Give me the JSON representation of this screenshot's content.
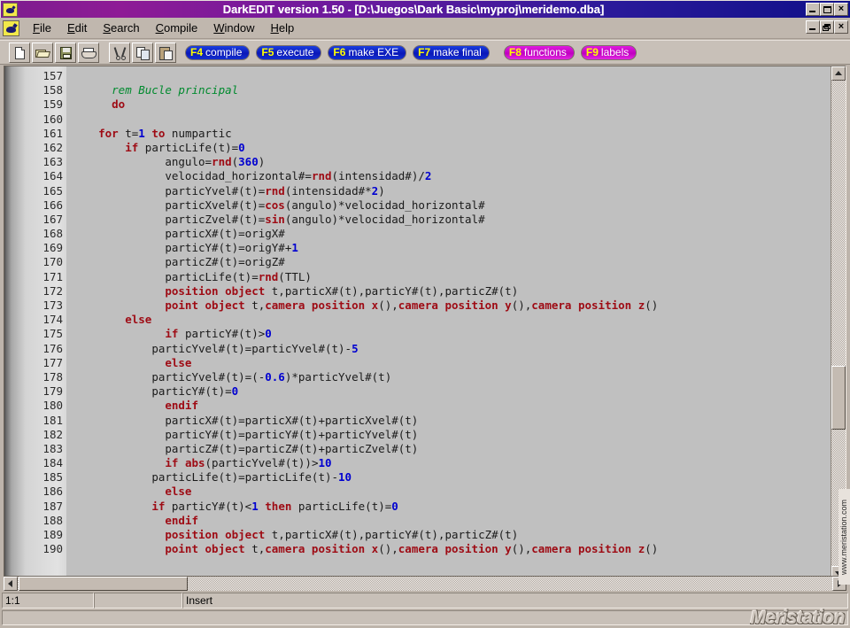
{
  "window": {
    "title": "DarkEDIT version 1.50 - [D:\\Juegos\\Dark Basic\\myproj\\meridemo.dba]",
    "app_icon": "darkedit-icon",
    "controls": [
      "minimize",
      "maximize",
      "close"
    ],
    "mdi_controls": [
      "minimize",
      "restore",
      "close"
    ]
  },
  "menu": {
    "items": [
      {
        "label": "File",
        "accel": "F"
      },
      {
        "label": "Edit",
        "accel": "E"
      },
      {
        "label": "Search",
        "accel": "S"
      },
      {
        "label": "Compile",
        "accel": "C"
      },
      {
        "label": "Window",
        "accel": "W"
      },
      {
        "label": "Help",
        "accel": "H"
      }
    ]
  },
  "toolbar": {
    "icon_buttons": [
      {
        "name": "new-file-button",
        "icon": "new-document-icon"
      },
      {
        "name": "open-file-button",
        "icon": "open-folder-icon"
      },
      {
        "name": "save-file-button",
        "icon": "floppy-disk-icon"
      },
      {
        "name": "print-button",
        "icon": "printer-icon"
      },
      {
        "name": "cut-button",
        "icon": "scissors-icon"
      },
      {
        "name": "copy-button",
        "icon": "copy-icon"
      },
      {
        "name": "paste-button",
        "icon": "clipboard-paste-icon"
      }
    ],
    "fkeys": [
      {
        "key": "F4",
        "label": "compile",
        "color": "#0b18b8"
      },
      {
        "key": "F5",
        "label": "execute",
        "color": "#0b18b8"
      },
      {
        "key": "F6",
        "label": "make EXE",
        "color": "#0b18b8"
      },
      {
        "key": "F7",
        "label": "make final",
        "color": "#0b18b8"
      },
      {
        "key": "F8",
        "label": "functions",
        "color": "#c000c0"
      },
      {
        "key": "F9",
        "label": "labels",
        "color": "#c000c0"
      }
    ]
  },
  "editor": {
    "first_line": 157,
    "last_line": 190,
    "line_numbers": [
      157,
      158,
      159,
      160,
      161,
      162,
      163,
      164,
      165,
      166,
      167,
      168,
      169,
      170,
      171,
      172,
      173,
      174,
      175,
      176,
      177,
      178,
      179,
      180,
      181,
      182,
      183,
      184,
      185,
      186,
      187,
      188,
      189,
      190
    ],
    "lines": [
      {
        "n": 157,
        "indent": 0,
        "tokens": []
      },
      {
        "n": 158,
        "indent": 1,
        "tokens": [
          {
            "t": "rem Bucle principal",
            "c": "comment"
          }
        ]
      },
      {
        "n": 159,
        "indent": 1,
        "tokens": [
          {
            "t": "do",
            "c": "keyword"
          }
        ]
      },
      {
        "n": 160,
        "indent": 0,
        "tokens": []
      },
      {
        "n": 161,
        "indent": 2,
        "tokens": [
          {
            "t": "for",
            "c": "keyword"
          },
          {
            "t": " t=",
            "c": "plain"
          },
          {
            "t": "1",
            "c": "number"
          },
          {
            "t": " ",
            "c": "plain"
          },
          {
            "t": "to",
            "c": "keyword"
          },
          {
            "t": " numpartic",
            "c": "plain"
          }
        ]
      },
      {
        "n": 162,
        "indent": 4,
        "tokens": [
          {
            "t": "if",
            "c": "keyword"
          },
          {
            "t": " particLife(t)=",
            "c": "plain"
          },
          {
            "t": "0",
            "c": "number"
          }
        ]
      },
      {
        "n": 163,
        "indent": 5,
        "tokens": [
          {
            "t": "angulo=",
            "c": "plain"
          },
          {
            "t": "rnd",
            "c": "keyword"
          },
          {
            "t": "(",
            "c": "plain"
          },
          {
            "t": "360",
            "c": "number"
          },
          {
            "t": ")",
            "c": "plain"
          }
        ]
      },
      {
        "n": 164,
        "indent": 5,
        "tokens": [
          {
            "t": "velocidad_horizontal#=",
            "c": "plain"
          },
          {
            "t": "rnd",
            "c": "keyword"
          },
          {
            "t": "(intensidad#)/",
            "c": "plain"
          },
          {
            "t": "2",
            "c": "number"
          }
        ]
      },
      {
        "n": 165,
        "indent": 5,
        "tokens": [
          {
            "t": "particYvel#(t)=",
            "c": "plain"
          },
          {
            "t": "rnd",
            "c": "keyword"
          },
          {
            "t": "(intensidad#*",
            "c": "plain"
          },
          {
            "t": "2",
            "c": "number"
          },
          {
            "t": ")",
            "c": "plain"
          }
        ]
      },
      {
        "n": 166,
        "indent": 5,
        "tokens": [
          {
            "t": "particXvel#(t)=",
            "c": "plain"
          },
          {
            "t": "cos",
            "c": "keyword"
          },
          {
            "t": "(angulo)*velocidad_horizontal#",
            "c": "plain"
          }
        ]
      },
      {
        "n": 167,
        "indent": 5,
        "tokens": [
          {
            "t": "particZvel#(t)=",
            "c": "plain"
          },
          {
            "t": "sin",
            "c": "keyword"
          },
          {
            "t": "(angulo)*velocidad_horizontal#",
            "c": "plain"
          }
        ]
      },
      {
        "n": 168,
        "indent": 5,
        "tokens": [
          {
            "t": "particX#(t)=origX#",
            "c": "plain"
          }
        ]
      },
      {
        "n": 169,
        "indent": 5,
        "tokens": [
          {
            "t": "particY#(t)=origY#+",
            "c": "plain"
          },
          {
            "t": "1",
            "c": "number"
          }
        ]
      },
      {
        "n": 170,
        "indent": 5,
        "tokens": [
          {
            "t": "particZ#(t)=origZ#",
            "c": "plain"
          }
        ]
      },
      {
        "n": 171,
        "indent": 5,
        "tokens": [
          {
            "t": "particLife(t)=",
            "c": "plain"
          },
          {
            "t": "rnd",
            "c": "keyword"
          },
          {
            "t": "(TTL)",
            "c": "plain"
          }
        ]
      },
      {
        "n": 172,
        "indent": 5,
        "tokens": [
          {
            "t": "position object",
            "c": "keyword"
          },
          {
            "t": " t,particX#(t),particY#(t),particZ#(t)",
            "c": "plain"
          }
        ]
      },
      {
        "n": 173,
        "indent": 5,
        "tokens": [
          {
            "t": "point object",
            "c": "keyword"
          },
          {
            "t": " t,",
            "c": "plain"
          },
          {
            "t": "camera position x",
            "c": "keyword"
          },
          {
            "t": "(),",
            "c": "plain"
          },
          {
            "t": "camera position y",
            "c": "keyword"
          },
          {
            "t": "(),",
            "c": "plain"
          },
          {
            "t": "camera position z",
            "c": "keyword"
          },
          {
            "t": "()",
            "c": "plain"
          }
        ]
      },
      {
        "n": 174,
        "indent": 4,
        "tokens": [
          {
            "t": "else",
            "c": "keyword"
          }
        ]
      },
      {
        "n": 175,
        "indent": 5,
        "tokens": [
          {
            "t": "if",
            "c": "keyword"
          },
          {
            "t": " particY#(t)>",
            "c": "plain"
          },
          {
            "t": "0",
            "c": "number"
          }
        ]
      },
      {
        "n": 176,
        "indent": 6,
        "tokens": [
          {
            "t": "particYvel#(t)=particYvel#(t)-",
            "c": "plain"
          },
          {
            "t": "5",
            "c": "number"
          }
        ]
      },
      {
        "n": 177,
        "indent": 5,
        "tokens": [
          {
            "t": "else",
            "c": "keyword"
          }
        ]
      },
      {
        "n": 178,
        "indent": 6,
        "tokens": [
          {
            "t": "particYvel#(t)=(-",
            "c": "plain"
          },
          {
            "t": "0.6",
            "c": "number"
          },
          {
            "t": ")*particYvel#(t)",
            "c": "plain"
          }
        ]
      },
      {
        "n": 179,
        "indent": 6,
        "tokens": [
          {
            "t": "particY#(t)=",
            "c": "plain"
          },
          {
            "t": "0",
            "c": "number"
          }
        ]
      },
      {
        "n": 180,
        "indent": 5,
        "tokens": [
          {
            "t": "endif",
            "c": "keyword"
          }
        ]
      },
      {
        "n": 181,
        "indent": 5,
        "tokens": [
          {
            "t": "particX#(t)=particX#(t)+particXvel#(t)",
            "c": "plain"
          }
        ]
      },
      {
        "n": 182,
        "indent": 5,
        "tokens": [
          {
            "t": "particY#(t)=particY#(t)+particYvel#(t)",
            "c": "plain"
          }
        ]
      },
      {
        "n": 183,
        "indent": 5,
        "tokens": [
          {
            "t": "particZ#(t)=particZ#(t)+particZvel#(t)",
            "c": "plain"
          }
        ]
      },
      {
        "n": 184,
        "indent": 5,
        "tokens": [
          {
            "t": "if",
            "c": "keyword"
          },
          {
            "t": " ",
            "c": "plain"
          },
          {
            "t": "abs",
            "c": "keyword"
          },
          {
            "t": "(particYvel#(t))>",
            "c": "plain"
          },
          {
            "t": "10",
            "c": "number"
          }
        ]
      },
      {
        "n": 185,
        "indent": 6,
        "tokens": [
          {
            "t": "particLife(t)=particLife(t)-",
            "c": "plain"
          },
          {
            "t": "10",
            "c": "number"
          }
        ]
      },
      {
        "n": 186,
        "indent": 5,
        "tokens": [
          {
            "t": "else",
            "c": "keyword"
          }
        ]
      },
      {
        "n": 187,
        "indent": 6,
        "tokens": [
          {
            "t": "if",
            "c": "keyword"
          },
          {
            "t": " particY#(t)<",
            "c": "plain"
          },
          {
            "t": "1",
            "c": "number"
          },
          {
            "t": " ",
            "c": "plain"
          },
          {
            "t": "then",
            "c": "keyword"
          },
          {
            "t": " particLife(t)=",
            "c": "plain"
          },
          {
            "t": "0",
            "c": "number"
          }
        ]
      },
      {
        "n": 188,
        "indent": 5,
        "tokens": [
          {
            "t": "endif",
            "c": "keyword"
          }
        ]
      },
      {
        "n": 189,
        "indent": 5,
        "tokens": [
          {
            "t": "position object",
            "c": "keyword"
          },
          {
            "t": " t,particX#(t),particY#(t),particZ#(t)",
            "c": "plain"
          }
        ]
      },
      {
        "n": 190,
        "indent": 5,
        "tokens": [
          {
            "t": "point object",
            "c": "keyword"
          },
          {
            "t": " t,",
            "c": "plain"
          },
          {
            "t": "camera position x",
            "c": "keyword"
          },
          {
            "t": "(),",
            "c": "plain"
          },
          {
            "t": "camera position y",
            "c": "keyword"
          },
          {
            "t": "(),",
            "c": "plain"
          },
          {
            "t": "camera position z",
            "c": "keyword"
          },
          {
            "t": "()",
            "c": "plain"
          }
        ]
      }
    ],
    "colors": {
      "keyword": "#9e0b14",
      "number": "#0000d0",
      "comment": "#008a2e",
      "plain": "#1a1a1a",
      "background": "#c0c0c0"
    }
  },
  "statusbar": {
    "cursor_position": "1:1",
    "panel2": "",
    "insert_mode": "Insert"
  },
  "watermark": {
    "brand": "Meristation",
    "url": "www.meristation.com"
  }
}
